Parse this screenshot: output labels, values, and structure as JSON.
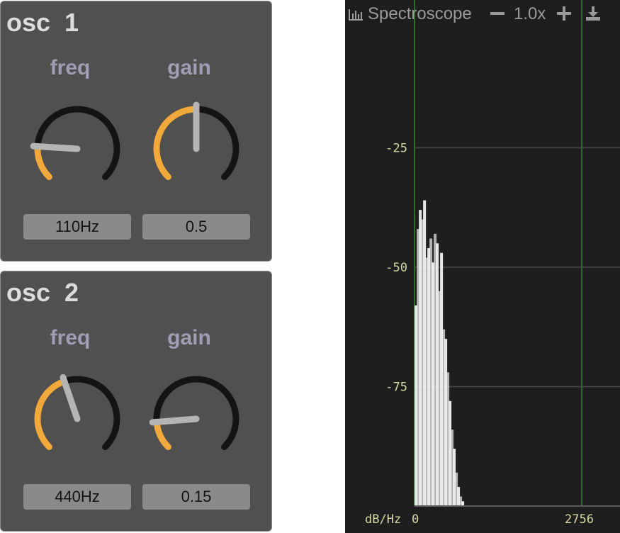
{
  "oscillators": [
    {
      "title": "osc  1",
      "knobs": [
        {
          "label": "freq",
          "value_text": "110Hz",
          "level": 0.18
        },
        {
          "label": "gain",
          "value_text": "0.5",
          "level": 0.5
        }
      ]
    },
    {
      "title": "osc  2",
      "knobs": [
        {
          "label": "freq",
          "value_text": "440Hz",
          "level": 0.43
        },
        {
          "label": "gain",
          "value_text": "0.15",
          "level": 0.15
        }
      ]
    }
  ],
  "spectroscope": {
    "title": "Spectroscope",
    "title_icon": "bar-chart-icon",
    "zoom_out_icon": "minus-icon",
    "zoom_text": "1.0x",
    "zoom_in_icon": "plus-icon",
    "download_icon": "download-icon",
    "ylabel": "dB/Hz",
    "y_ticks": [
      "-25",
      "-50",
      "-75"
    ],
    "x_ticks": [
      "0",
      "2756"
    ]
  },
  "colors": {
    "panel_bg": "#505050",
    "knob_active": "#f2a93b",
    "knob_track": "#141414",
    "knob_pointer": "#b4b4b4",
    "label_color": "#a09cb4",
    "spectro_bg": "#1e1e1e",
    "spectro_axis_text": "#d8d6a0",
    "spectro_grid": "#4a4a4a",
    "spectro_marker": "#2f6b2f"
  },
  "chart_data": {
    "type": "area",
    "ylabel": "dB/Hz",
    "xlim": [
      0,
      2756
    ],
    "ylim": [
      -100,
      0
    ],
    "y_ticks": [
      -25,
      -50,
      -75
    ],
    "x_ticks": [
      0,
      2756
    ],
    "series": [
      {
        "x": [
          25,
          60,
          95,
          130,
          165,
          200,
          235,
          270,
          305,
          340,
          375,
          410,
          445,
          480,
          515,
          550,
          585,
          620,
          655,
          690,
          725,
          760,
          795
        ],
        "values": [
          -58,
          -42,
          -38,
          -40,
          -36,
          -48,
          -46,
          -44,
          -49,
          -43,
          -45,
          -55,
          -47,
          -63,
          -65,
          -72,
          -78,
          -84,
          -88,
          -93,
          -96,
          -98,
          -99
        ]
      }
    ]
  }
}
